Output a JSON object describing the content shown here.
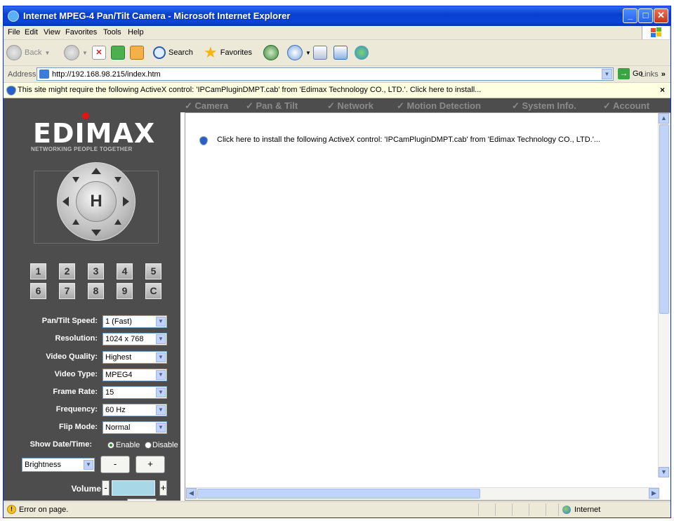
{
  "window": {
    "title": "Internet MPEG-4 Pan/Tilt Camera - Microsoft Internet Explorer",
    "controls": [
      "_",
      "□",
      "✕"
    ]
  },
  "menu": [
    "File",
    "Edit",
    "View",
    "Favorites",
    "Tools",
    "Help"
  ],
  "toolbar": {
    "back": "Back",
    "search": "Search",
    "favorites": "Favorites"
  },
  "address": {
    "label": "Address",
    "url": "http://192.168.98.215/index.htm",
    "go": "Go",
    "links": "Links"
  },
  "infobar": {
    "message": "This site might require the following ActiveX control: 'IPCamPluginDMPT.cab' from 'Edimax Technology CO., LTD.'. Click here to install...",
    "close": "×"
  },
  "brand": {
    "logo": "EDIMAX",
    "tagline": "NETWORKING PEOPLE TOGETHER"
  },
  "ptz": {
    "home": "H"
  },
  "presets": [
    "1",
    "2",
    "3",
    "4",
    "5",
    "6",
    "7",
    "8",
    "9",
    "C"
  ],
  "settings": [
    {
      "label": "Pan/Tilt Speed:",
      "value": "1 (Fast)"
    },
    {
      "label": "Resolution:",
      "value": "1024 x 768"
    },
    {
      "label": "Video Quality:",
      "value": "Highest"
    },
    {
      "label": "Video Type:",
      "value": "MPEG4"
    },
    {
      "label": "Frame Rate:",
      "value": "15"
    },
    {
      "label": "Frequency:",
      "value": "60 Hz"
    },
    {
      "label": "Flip Mode:",
      "value": "Normal"
    }
  ],
  "date_time": {
    "label": "Show Date/Time:",
    "enable": "Enable",
    "disable": "Disable",
    "selected": "Enable"
  },
  "adjust": {
    "select": "Brightness",
    "minus": "-",
    "plus": "+"
  },
  "volume": {
    "label": "Volume",
    "minus": "-",
    "plus": "+"
  },
  "nav_tabs": [
    "✓ Camera",
    "✓ Pan & Tilt",
    "✓ Network",
    "✓ Motion Detection",
    "✓ System Info.",
    "✓ Account"
  ],
  "activex_notice": "Click here to install the following ActiveX control: 'IPCamPluginDMPT.cab' from 'Edimax Technology CO., LTD.'...",
  "status": {
    "text": "Error on page.",
    "zone": "Internet"
  },
  "colors": {
    "sidebar": "#4d4d4d",
    "titlebar": "#0a44d8",
    "infobar": "#ffffe1"
  }
}
